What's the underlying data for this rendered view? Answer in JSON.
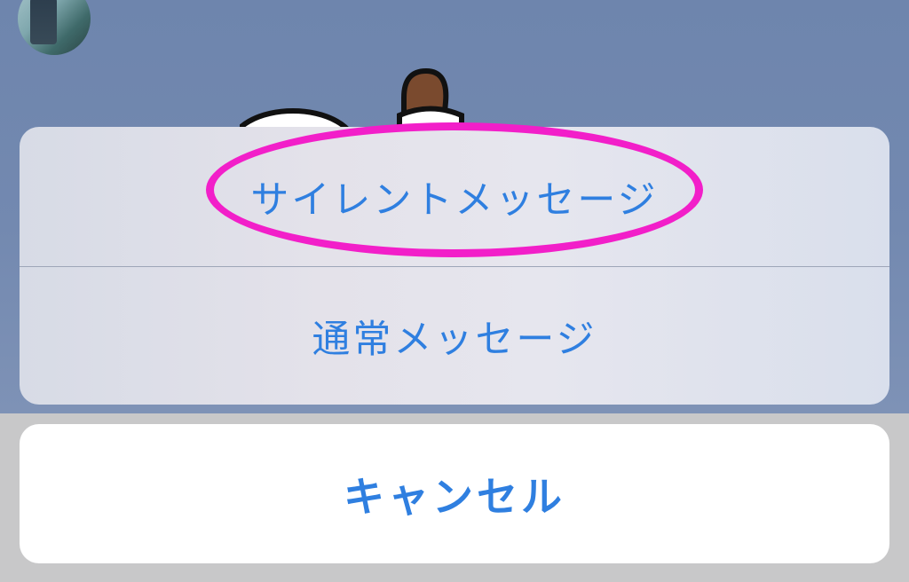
{
  "action_sheet": {
    "options": [
      {
        "label": "サイレントメッセージ"
      },
      {
        "label": "通常メッセージ"
      }
    ],
    "cancel_label": "キャンセル"
  },
  "colors": {
    "action_text": "#2f7fe0",
    "highlight_marker": "#f21fc9",
    "backdrop": "#7389b0"
  },
  "icons": {
    "avatar": "avatar",
    "sticker": "sticker-image"
  }
}
